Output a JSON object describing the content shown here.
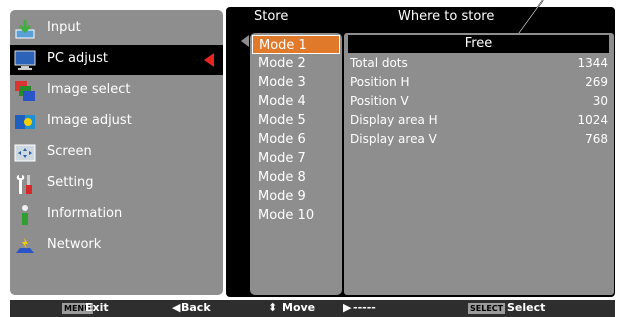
{
  "menu": {
    "items": [
      {
        "label": "Input",
        "icon": "input-icon"
      },
      {
        "label": "PC adjust",
        "icon": "pc-monitor-icon"
      },
      {
        "label": "Image select",
        "icon": "image-select-icon"
      },
      {
        "label": "Image adjust",
        "icon": "image-adjust-icon"
      },
      {
        "label": "Screen",
        "icon": "screen-icon"
      },
      {
        "label": "Setting",
        "icon": "setting-tools-icon"
      },
      {
        "label": "Information",
        "icon": "information-icon"
      },
      {
        "label": "Network",
        "icon": "network-icon"
      }
    ],
    "selected_index": 1
  },
  "store": {
    "header": "Store",
    "where_header": "Where to store",
    "modes": [
      "Mode 1",
      "Mode 2",
      "Mode 3",
      "Mode 4",
      "Mode 5",
      "Mode 6",
      "Mode 7",
      "Mode 8",
      "Mode 9",
      "Mode 10"
    ],
    "selected_index": 0
  },
  "info": {
    "status": "Free",
    "rows": [
      {
        "label": "Total dots",
        "value": "1344"
      },
      {
        "label": "Position H",
        "value": "269"
      },
      {
        "label": "Position V",
        "value": "30"
      },
      {
        "label": "Display area H",
        "value": "1024"
      },
      {
        "label": "Display area V",
        "value": "768"
      }
    ]
  },
  "status_bar": {
    "menu_key": "MENU",
    "exit": "Exit",
    "back": "Back",
    "move": "Move",
    "next": "-----",
    "select_key": "SELECT",
    "select": "Select"
  },
  "colors": {
    "panel_gray": "#8e8e8e",
    "selected_mode": "#e07a2a",
    "selection_arrow": "#e8241f",
    "background": "#000000"
  }
}
